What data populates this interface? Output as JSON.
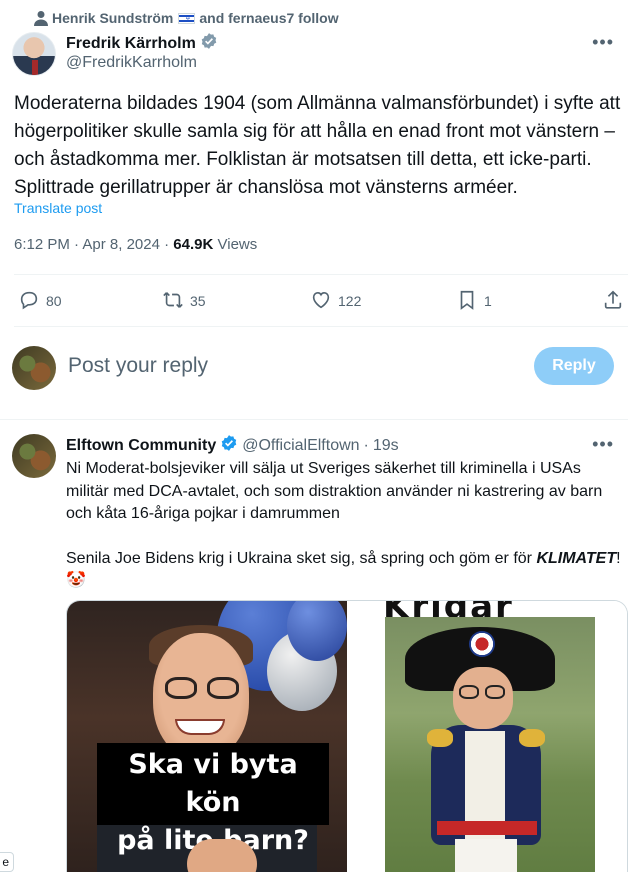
{
  "social_context": {
    "text_prefix": "Henrik Sundström",
    "text_suffix": "and fernaeus7 follow",
    "icon": "person-icon",
    "flag_icon": "israel-flag-icon"
  },
  "main_tweet": {
    "author_name": "Fredrik Kärrholm",
    "author_handle": "@FredrikKarrholm",
    "verified": true,
    "text": "Moderaterna bildades 1904 (som Allmänna valmansförbundet) i syfte att\nhögerpolitiker skulle samla sig för att hålla en enad front mot vänstern –\noch åstadkomma mer. Folklistan är motsatsen till detta, ett icke-parti.\nSplittrade gerillatrupper är chanslösa mot vänsterns arméer.",
    "translate_label": "Translate post",
    "time": "6:12 PM",
    "separator": "·",
    "date": "Apr 8, 2024",
    "views_count": "64.9K",
    "views_label": "Views",
    "actions": {
      "replies": "80",
      "reposts": "35",
      "likes": "122",
      "bookmarks": "1"
    }
  },
  "reply_compose": {
    "placeholder": "Post your reply",
    "button_label": "Reply"
  },
  "reply_tweet": {
    "author_name": "Elftown Community",
    "author_handle": "@OfficialElftown",
    "separator": "·",
    "time": "19s",
    "verified": true,
    "paragraph1": "Ni Moderat-bolsjeviker vill sälja ut Sveriges säkerhet till kriminella i USAs militär med DCA-avtalet, och som distraktion använder ni kastrering av barn och kåta 16-åriga pojkar i damrummen",
    "paragraph2_prefix": "Senila Joe Bidens krig i Ukraina sket sig, så spring och göm er för ",
    "paragraph2_bold": "KLIMATET",
    "paragraph2_suffix": "! 🤡",
    "media": {
      "left_caption_line1": "Ska vi byta kön",
      "left_caption_line2": "på lite barn?",
      "right_title": "Krigar"
    }
  },
  "left_tab_label": "e",
  "colors": {
    "accent": "#1d9bf0",
    "reply_button_disabled": "#8ecdf8",
    "secondary_text": "#536471",
    "divider": "#eff3f4"
  }
}
